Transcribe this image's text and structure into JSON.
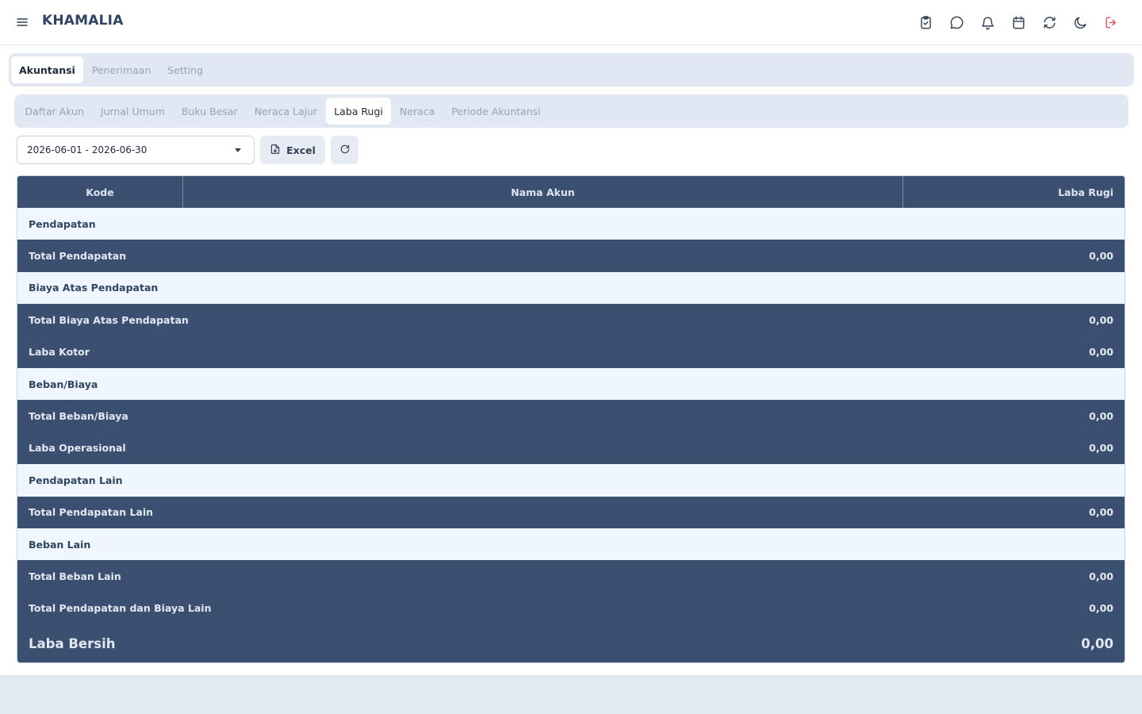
{
  "app": {
    "brand": "KHAMALIA"
  },
  "topbar": {
    "icons": [
      "clipboard-check-icon",
      "chat-bubble-icon",
      "bell-icon",
      "calendar-icon",
      "sync-icon",
      "moon-icon",
      "logout-icon"
    ]
  },
  "main_tabs": [
    {
      "label": "Akuntansi",
      "active": true
    },
    {
      "label": "Penerimaan",
      "active": false
    },
    {
      "label": "Setting",
      "active": false
    }
  ],
  "sub_tabs": [
    {
      "label": "Daftar Akun",
      "active": false
    },
    {
      "label": "Jurnal Umum",
      "active": false
    },
    {
      "label": "Buku Besar",
      "active": false
    },
    {
      "label": "Neraca Lajur",
      "active": false
    },
    {
      "label": "Laba Rugi",
      "active": true
    },
    {
      "label": "Neraca",
      "active": false
    },
    {
      "label": "Periode Akuntansi",
      "active": false
    }
  ],
  "toolbar": {
    "date_range": "2026-06-01 - 2026-06-30",
    "excel_label": "Excel"
  },
  "table": {
    "headers": {
      "kode": "Kode",
      "nama": "Nama Akun",
      "laba": "Laba Rugi"
    },
    "rows": [
      {
        "type": "section",
        "label": "Pendapatan",
        "value": ""
      },
      {
        "type": "total",
        "label": "Total Pendapatan",
        "value": "0,00"
      },
      {
        "type": "section",
        "label": "Biaya Atas Pendapatan",
        "value": ""
      },
      {
        "type": "total",
        "label": "Total Biaya Atas Pendapatan",
        "value": "0,00"
      },
      {
        "type": "total",
        "label": "Laba Kotor",
        "value": "0,00"
      },
      {
        "type": "section",
        "label": "Beban/Biaya",
        "value": ""
      },
      {
        "type": "total",
        "label": "Total Beban/Biaya",
        "value": "0,00"
      },
      {
        "type": "total",
        "label": "Laba Operasional",
        "value": "0,00"
      },
      {
        "type": "section",
        "label": "Pendapatan Lain",
        "value": ""
      },
      {
        "type": "total",
        "label": "Total Pendapatan Lain",
        "value": "0,00"
      },
      {
        "type": "section",
        "label": "Beban Lain",
        "value": ""
      },
      {
        "type": "total",
        "label": "Total Beban Lain",
        "value": "0,00"
      },
      {
        "type": "total",
        "label": "Total Pendapatan dan Biaya Lain",
        "value": "0,00"
      },
      {
        "type": "final",
        "label": "Laba Bersih",
        "value": "0,00"
      }
    ]
  },
  "colors": {
    "header_dark": "#3b5070",
    "section_bg": "#f0f6fd",
    "logout_accent": "#e0545e"
  }
}
